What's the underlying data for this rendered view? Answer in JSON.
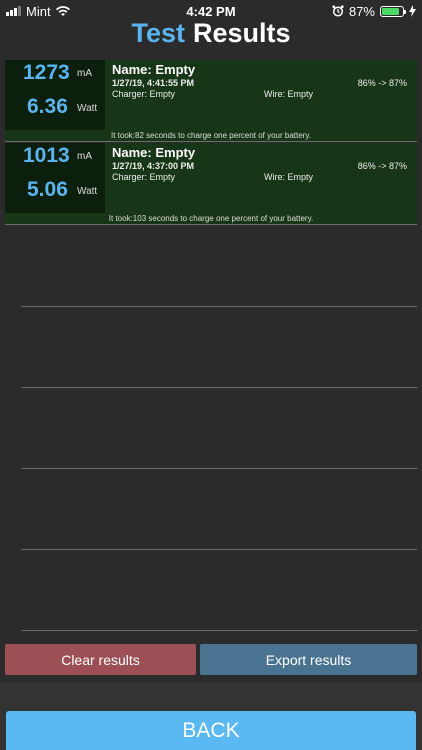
{
  "status_bar": {
    "carrier": "Mint",
    "time": "4:42 PM",
    "battery_pct": "87%",
    "battery_level": 0.87
  },
  "header": {
    "title_part1": "Test",
    "title_part2": "Results"
  },
  "results": [
    {
      "ma": "1273",
      "ma_unit": "mA",
      "watt": "6.36",
      "watt_unit": "Watt",
      "name": "Name: Empty",
      "date": "1/27/19, 4:41:55 PM",
      "charger": "Charger: Empty",
      "wire": "Wire: Empty",
      "pct": "86% -> 87%",
      "footer": "It took:82 seconds to charge one percent of your battery."
    },
    {
      "ma": "1013",
      "ma_unit": "mA",
      "watt": "5.06",
      "watt_unit": "Watt",
      "name": "Name: Empty",
      "date": "1/27/19, 4:37:00 PM",
      "charger": "Charger: Empty",
      "wire": "Wire: Empty",
      "pct": "86% -> 87%",
      "footer": "It took:103 seconds to charge one percent of your battery."
    }
  ],
  "buttons": {
    "clear": "Clear results",
    "export": "Export results",
    "back": "BACK"
  },
  "colors": {
    "accent": "#5ab4f0",
    "card_bg": "#173517",
    "clear_btn": "#9c4f55",
    "export_btn": "#4a7391",
    "back_btn": "#5ab8f2"
  }
}
